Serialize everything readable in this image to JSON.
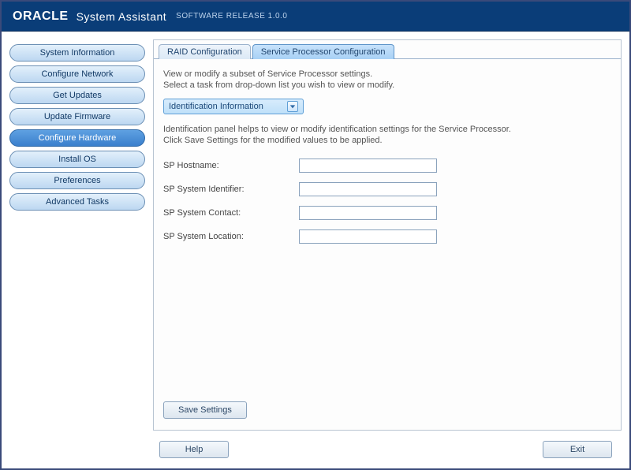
{
  "header": {
    "brand": "ORACLE",
    "title": "System Assistant",
    "release_label": "SOFTWARE RELEASE  1.0.0"
  },
  "sidebar": {
    "items": [
      {
        "label": "System Information"
      },
      {
        "label": "Configure Network"
      },
      {
        "label": "Get Updates"
      },
      {
        "label": "Update Firmware"
      },
      {
        "label": "Configure Hardware"
      },
      {
        "label": "Install OS"
      },
      {
        "label": "Preferences"
      },
      {
        "label": "Advanced Tasks"
      }
    ],
    "selected_index": 4
  },
  "tabs": [
    {
      "label": "RAID Configuration"
    },
    {
      "label": "Service Processor Configuration"
    }
  ],
  "active_tab_index": 1,
  "content": {
    "description_line1": "View or modify a subset of Service Processor settings.",
    "description_line2": "Select a task from drop-down list you wish to view or modify.",
    "dropdown": {
      "selected": "Identification Information"
    },
    "help_line1": "Identification panel helps to view or modify identification settings for the Service Processor.",
    "help_line2": "Click Save Settings for the modified values to be applied.",
    "fields": [
      {
        "label": "SP Hostname:",
        "value": ""
      },
      {
        "label": "SP System Identifier:",
        "value": ""
      },
      {
        "label": "SP System Contact:",
        "value": ""
      },
      {
        "label": "SP System Location:",
        "value": ""
      }
    ],
    "save_label": "Save Settings"
  },
  "footer": {
    "help_label": "Help",
    "exit_label": "Exit"
  }
}
